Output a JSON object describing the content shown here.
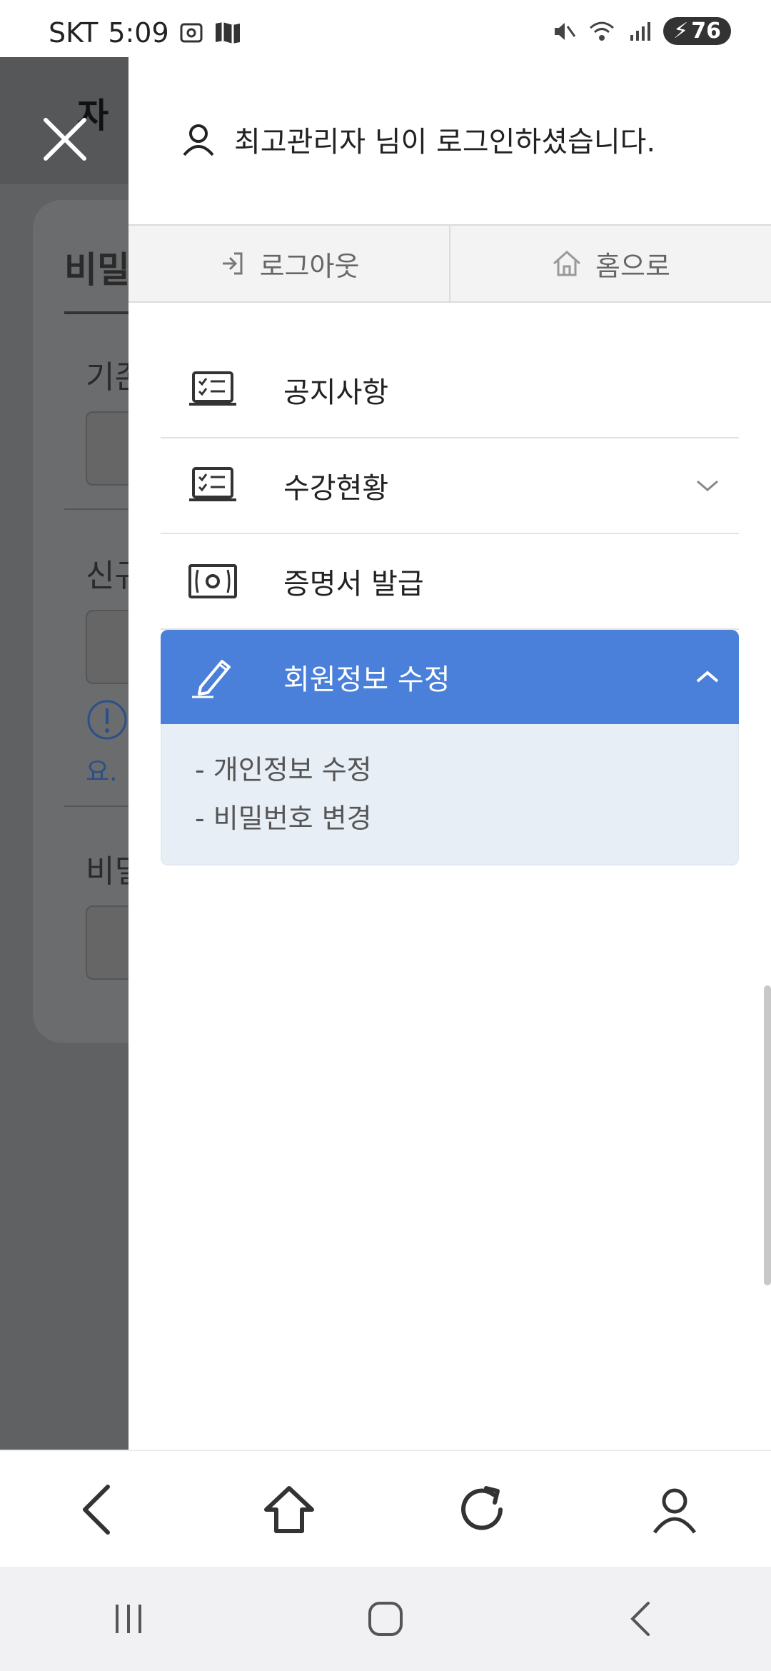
{
  "status_bar": {
    "carrier": "SKT",
    "time": "5:09",
    "battery": "76"
  },
  "background_page": {
    "title_fragment": "자",
    "tab_fragment": "비밀",
    "label_1": "기존",
    "label_2": "신규",
    "note_fragment": "요.",
    "label_3": "비밀"
  },
  "drawer": {
    "user_message": "최고관리자 님이 로그인하셨습니다.",
    "actions": {
      "logout": "로그아웃",
      "home": "홈으로"
    },
    "menu": [
      {
        "label": "공지사항",
        "icon": "notice-board-icon"
      },
      {
        "label": "수강현황",
        "icon": "course-status-icon"
      },
      {
        "label": "증명서 발급",
        "icon": "certificate-icon"
      },
      {
        "label": "회원정보 수정",
        "icon": "pencil-icon"
      }
    ],
    "submenu": [
      "- 개인정보 수정",
      "- 비밀번호 변경"
    ]
  },
  "browser_toolbar": [
    "back-icon",
    "home-icon",
    "refresh-icon",
    "account-icon"
  ],
  "system_nav": [
    "recent-apps-icon",
    "home-button-icon",
    "back-button-icon"
  ],
  "colors": {
    "accent": "#4a80d9",
    "submenu_bg": "#e8eef6",
    "overlay": "#5f6163"
  }
}
